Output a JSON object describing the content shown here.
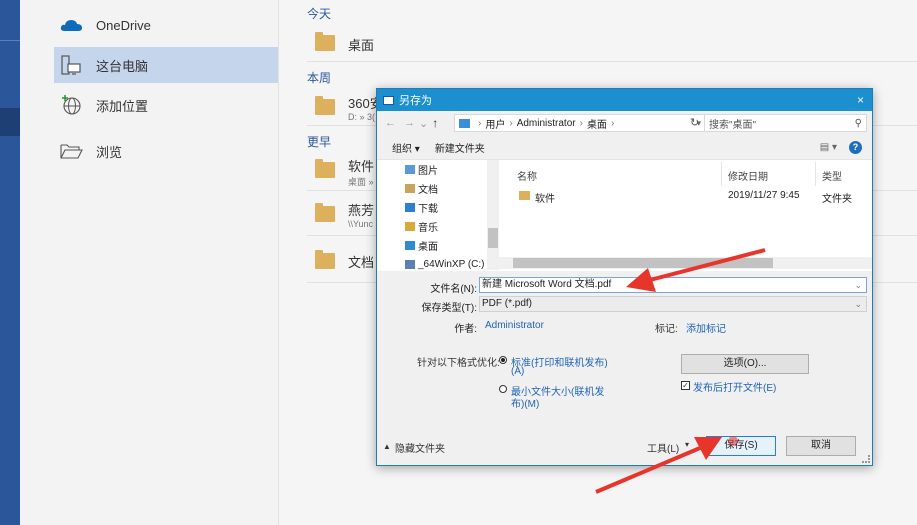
{
  "places": {
    "items": [
      {
        "label": "OneDrive",
        "icon": "onedrive-cloud-icon"
      },
      {
        "label": "这台电脑",
        "icon": "this-pc-icon",
        "selected": true
      },
      {
        "label": "添加位置",
        "icon": "globe-plus-icon"
      },
      {
        "label": "浏览",
        "icon": "open-folder-icon"
      }
    ]
  },
  "recent": {
    "groups": [
      {
        "label": "今天",
        "items": [
          {
            "name": "桌面",
            "path": ""
          }
        ]
      },
      {
        "label": "本周",
        "items": [
          {
            "name": "360安",
            "path": "D: » 3("
          }
        ]
      },
      {
        "label": "更早",
        "items": [
          {
            "name": "软件",
            "path": "桌面 »"
          },
          {
            "name": "燕芳",
            "path": "\\\\Yunc"
          },
          {
            "name": "文档",
            "path": ""
          }
        ]
      }
    ]
  },
  "dialog": {
    "title": "另存为",
    "close": "×",
    "nav": {
      "back": "←",
      "forward": "→",
      "recent": "⌄",
      "up": "↑"
    },
    "address": {
      "segments": [
        "用户",
        "Administrator",
        "桌面"
      ],
      "lead": "›",
      "sep": "›"
    },
    "refresh": "↻",
    "search_placeholder": "搜索\"桌面\"",
    "toolbar": {
      "organize": "组织 ▾",
      "new_folder": "新建文件夹",
      "view": "▤ ▾",
      "help": "?"
    },
    "tree": [
      "图片",
      "文档",
      "下载",
      "音乐",
      "桌面",
      "_64WinXP (C:)"
    ],
    "columns": {
      "name": "名称",
      "modified": "修改日期",
      "type": "类型"
    },
    "files": [
      {
        "name": "软件",
        "modified": "2019/11/27 9:45",
        "type": "文件夹"
      }
    ],
    "filename_label": "文件名(N):",
    "filename_value": "新建 Microsoft Word 文档.pdf",
    "filetype_label": "保存类型(T):",
    "filetype_value": "PDF (*.pdf)",
    "author_label": "作者:",
    "author_value": "Administrator",
    "tags_label": "标记:",
    "tags_value": "添加标记",
    "optimize_label": "针对以下格式优化:",
    "opt_standard": [
      "标准(打印和联机发布)",
      "(A)"
    ],
    "opt_minimum": [
      "最小文件大小(联机发",
      "布)(M)"
    ],
    "options_button": "选项(O)...",
    "open_after_publish": "发布后打开文件(E)",
    "hide_folders": "隐藏文件夹",
    "tools": "工具(L)",
    "save": "保存(S)",
    "cancel": "取消"
  },
  "colors": {
    "accent": "#2b579a",
    "dialog_title": "#1c8fce",
    "arrow": "#e8352b",
    "link": "#1f63b7"
  }
}
